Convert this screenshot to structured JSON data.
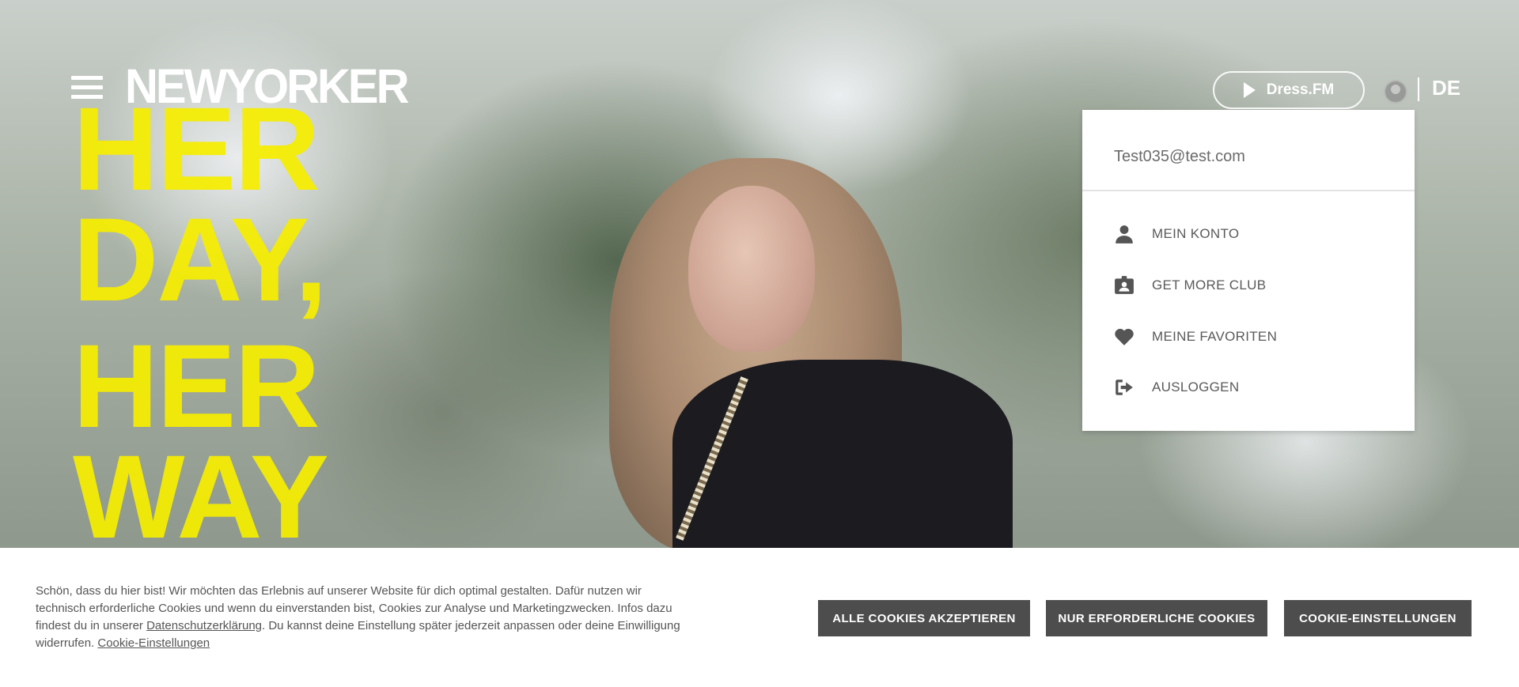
{
  "header": {
    "logo_text": "NEWYORKER",
    "dress_fm_label": "Dress.FM",
    "language": "DE"
  },
  "hero": {
    "headline_lines": [
      "HER",
      "DAY,",
      "HER",
      "WAY"
    ]
  },
  "account_menu": {
    "email": "Test035@test.com",
    "items": [
      {
        "label": "MEIN KONTO",
        "icon": "person-icon"
      },
      {
        "label": "GET MORE CLUB",
        "icon": "member-card-icon"
      },
      {
        "label": "MEINE FAVORITEN",
        "icon": "heart-icon"
      },
      {
        "label": "AUSLOGGEN",
        "icon": "logout-icon"
      }
    ]
  },
  "cookie_banner": {
    "text_part1": "Schön, dass du hier bist! Wir möchten das Erlebnis auf unserer Website für dich optimal gestalten. Dafür nutzen wir technisch erforderliche Cookies und wenn du einverstanden bist, Cookies zur Analyse und Marketingzwecken. Infos dazu findest du in unserer ",
    "privacy_link": "Datenschutzerklärung",
    "text_part2": ". Du kannst deine Einstellung später jederzeit anpassen oder deine Einwilligung widerrufen. ",
    "settings_link": "Cookie-Einstellungen",
    "buttons": {
      "accept_all": "ALLE COOKIES AKZEPTIEREN",
      "necessary_only": "NUR ERFORDERLICHE COOKIES",
      "settings": "COOKIE-EINSTELLUNGEN"
    }
  },
  "colors": {
    "headline": "#f6ee00",
    "button_bg": "#4d4d4d",
    "menu_text": "#5a5a5a"
  }
}
